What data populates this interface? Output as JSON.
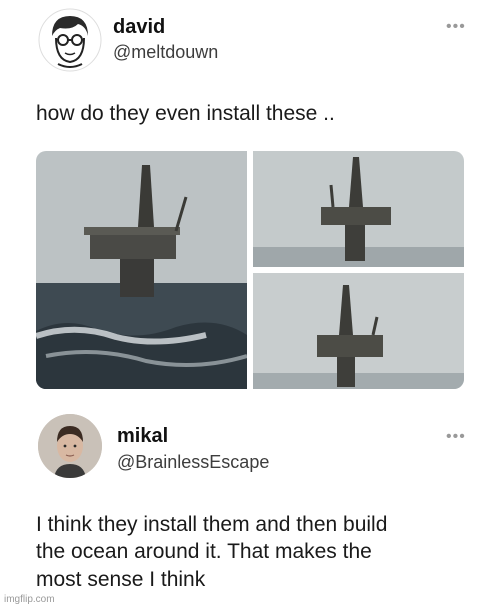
{
  "tweet1": {
    "name": "david",
    "handle": "@meltdouwn",
    "more": "•••",
    "text": "how do they even install these .."
  },
  "tweet2": {
    "name": "mikal",
    "handle": "@BrainlessEscape",
    "more": "•••",
    "text_lines": [
      "I think they install them and then build",
      "the ocean around it. That makes the",
      "most sense I think"
    ]
  },
  "watermark": "imgflip.com",
  "icons": {
    "avatar1": "sketch-avatar-icon",
    "avatar2": "photo-avatar-icon",
    "more": "more-options-icon"
  }
}
